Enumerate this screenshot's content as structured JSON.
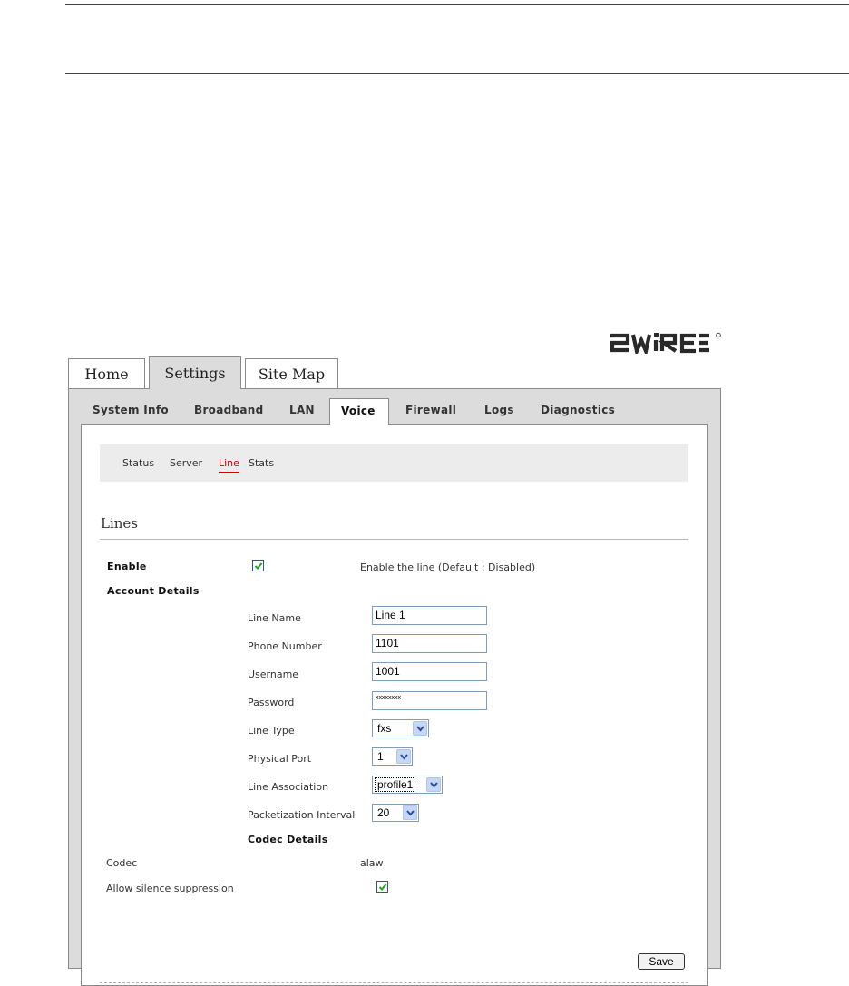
{
  "brand": {
    "logo_text": "2WIRE"
  },
  "top_tabs": [
    {
      "label": "Home"
    },
    {
      "label": "Settings"
    },
    {
      "label": "Site Map"
    }
  ],
  "sub_tabs": [
    {
      "label": "System Info"
    },
    {
      "label": "Broadband"
    },
    {
      "label": "LAN"
    },
    {
      "label": "Voice"
    },
    {
      "label": "Firewall"
    },
    {
      "label": "Logs"
    },
    {
      "label": "Diagnostics"
    }
  ],
  "third_nav": [
    {
      "label": "Status"
    },
    {
      "label": "Server"
    },
    {
      "label": "Line"
    },
    {
      "label": "Stats"
    }
  ],
  "section_title": "Lines",
  "form": {
    "enable_label": "Enable",
    "enable_checked": true,
    "enable_hint": "Enable the line (Default : Disabled)",
    "account_details_label": "Account Details",
    "line_name_label": "Line Name",
    "line_name_value": "Line 1",
    "phone_number_label": "Phone Number",
    "phone_number_value": "1101",
    "username_label": "Username",
    "username_value": "1001",
    "password_label": "Password",
    "password_value": "xxxxxxxx",
    "line_type_label": "Line Type",
    "line_type_value": "fxs",
    "physical_port_label": "Physical Port",
    "physical_port_value": "1",
    "line_association_label": "Line Association",
    "line_association_value": "profile1",
    "packetization_label": "Packetization Interval",
    "packetization_value": "20",
    "codec_details_label": "Codec Details",
    "codec_label": "Codec",
    "codec_value": "alaw",
    "silence_label": "Allow silence suppression",
    "silence_checked": true,
    "save_label": "Save"
  },
  "colors": {
    "active_link": "#cc0000",
    "panel_bg": "#dcdcdc",
    "input_border": "#7f9db9",
    "checkmark": "#21a121"
  }
}
